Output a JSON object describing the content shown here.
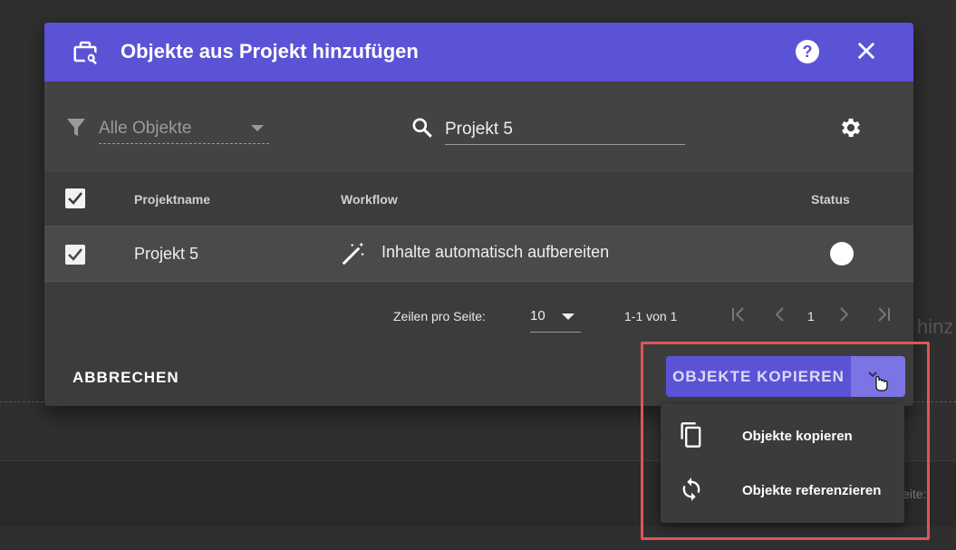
{
  "dialog": {
    "title": "Objekte aus Projekt hinzufügen",
    "header_color": "#5b53d6",
    "help_label": "?"
  },
  "toolbar": {
    "filter_value": "Alle Objekte",
    "search_value": "Projekt 5"
  },
  "table": {
    "columns": [
      "Projektname",
      "Workflow",
      "Status"
    ],
    "rows": [
      {
        "projektname": "Projekt 5",
        "workflow": "Inhalte automatisch aufbereiten",
        "selected": true
      }
    ]
  },
  "pagination": {
    "rows_label": "Zeilen pro Seite:",
    "rows_per_page": "10",
    "range": "1-1 von 1",
    "page": "1"
  },
  "actions": {
    "cancel_label": "ABBRECHEN",
    "primary_label": "OBJEKTE KOPIEREN",
    "menu_items": [
      "Objekte kopieren",
      "Objekte referenzieren"
    ]
  },
  "background": {
    "fragment_1": "hinz",
    "fragment_2": "eite:"
  },
  "colors": {
    "accent": "#5b53d6",
    "highlight": "#e05555"
  }
}
